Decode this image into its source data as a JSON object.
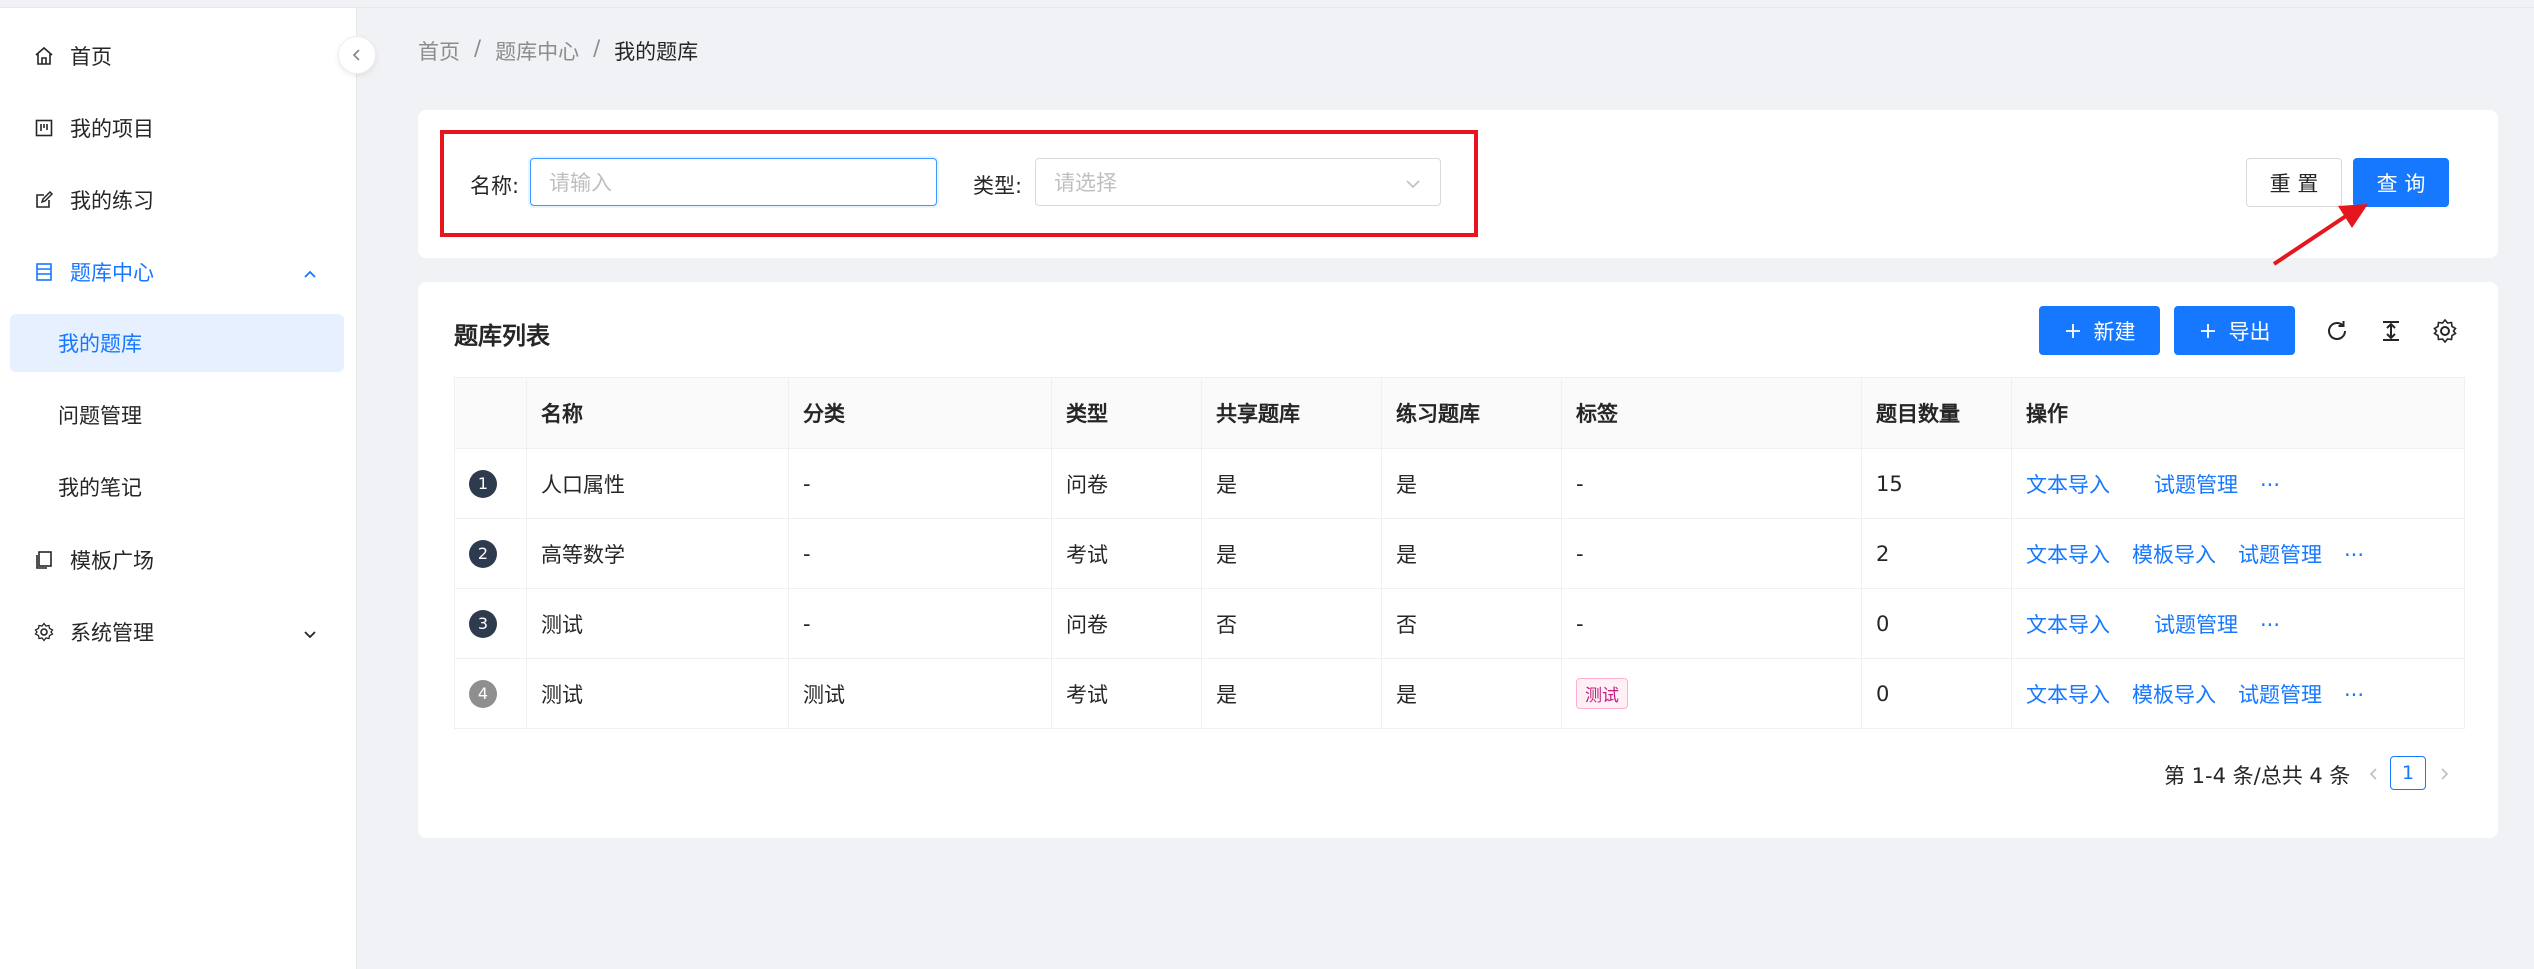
{
  "sidebar": {
    "items": [
      {
        "label": "首页",
        "icon": "home-icon"
      },
      {
        "label": "我的项目",
        "icon": "project-icon"
      },
      {
        "label": "我的练习",
        "icon": "edit-icon"
      },
      {
        "label": "题库中心",
        "icon": "database-icon",
        "expanded": true
      },
      {
        "label": "模板广场",
        "icon": "copy-icon"
      },
      {
        "label": "系统管理",
        "icon": "gear-icon",
        "expanded": false
      }
    ],
    "submenu": [
      {
        "label": "我的题库",
        "selected": true
      },
      {
        "label": "问题管理"
      },
      {
        "label": "我的笔记"
      }
    ]
  },
  "breadcrumb": {
    "items": [
      "首页",
      "题库中心",
      "我的题库"
    ],
    "separator": "/"
  },
  "search": {
    "name_label": "名称:",
    "name_placeholder": "请输入",
    "type_label": "类型:",
    "type_placeholder": "请选择",
    "reset_label": "重 置",
    "query_label": "查 询"
  },
  "table_card": {
    "title": "题库列表",
    "new_label": "新建",
    "export_label": "导出",
    "tools": [
      "refresh-icon",
      "column-height-icon",
      "setting-icon"
    ]
  },
  "table": {
    "columns": [
      "",
      "名称",
      "分类",
      "类型",
      "共享题库",
      "练习题库",
      "标签",
      "题目数量",
      "操作"
    ],
    "rows": [
      {
        "index": "1",
        "name": "人口属性",
        "category": "-",
        "type": "问卷",
        "shared": "是",
        "practice": "是",
        "tag": "-",
        "count": "15",
        "ops": [
          "文本导入",
          "",
          "试题管理"
        ],
        "more": "···"
      },
      {
        "index": "2",
        "name": "高等数学",
        "category": "-",
        "type": "考试",
        "shared": "是",
        "practice": "是",
        "tag": "-",
        "count": "2",
        "ops": [
          "文本导入",
          "模板导入",
          "试题管理"
        ],
        "more": "···"
      },
      {
        "index": "3",
        "name": "测试",
        "category": "-",
        "type": "问卷",
        "shared": "否",
        "practice": "否",
        "tag": "-",
        "count": "0",
        "ops": [
          "文本导入",
          "",
          "试题管理"
        ],
        "more": "···"
      },
      {
        "index": "4",
        "name": "测试",
        "category": "测试",
        "type": "考试",
        "shared": "是",
        "practice": "是",
        "tag": "测试",
        "count": "0",
        "ops": [
          "文本导入",
          "模板导入",
          "试题管理"
        ],
        "more": "···"
      }
    ]
  },
  "pagination": {
    "total_text": "第 1-4 条/总共 4 条",
    "current_page": "1"
  },
  "colors": {
    "primary": "#1677ff",
    "highlight": "#e6161e",
    "tag_text": "#c41d7f",
    "tag_bg": "#fff0f6"
  }
}
